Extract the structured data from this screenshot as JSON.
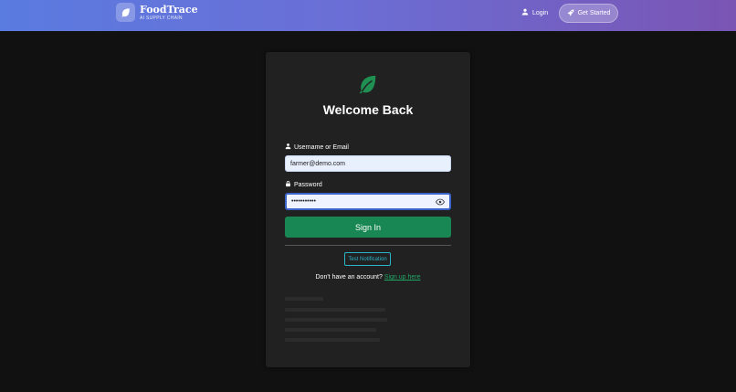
{
  "navbar": {
    "brand_title": "FoodTrace",
    "brand_subtitle": "AI SUPPLY CHAIN",
    "brand_icon": "leaf-icon",
    "login_label": "Login",
    "login_icon": "user-icon",
    "get_started_label": "Get Started",
    "get_started_icon": "rocket-icon"
  },
  "login_card": {
    "logo_icon": "leaf-icon",
    "title": "Welcome Back",
    "username": {
      "label": "Username or Email",
      "icon": "user-icon",
      "value": "farmer@demo.com"
    },
    "password": {
      "label": "Password",
      "icon": "lock-icon",
      "value": "•••••••••••",
      "toggle_icon": "eye-icon"
    },
    "sign_in_label": "Sign In",
    "test_notification_label": "Test Notification",
    "no_account_text": "Don't have an account?",
    "sign_up_link": "Sign up here"
  },
  "colors": {
    "navbar_gradient_start": "#5a7be0",
    "navbar_gradient_end": "#7a55b4",
    "background": "#111111",
    "card": "#212121",
    "primary_green": "#198754",
    "link_green": "#1fa764",
    "info_cyan": "#2bb3c9"
  }
}
